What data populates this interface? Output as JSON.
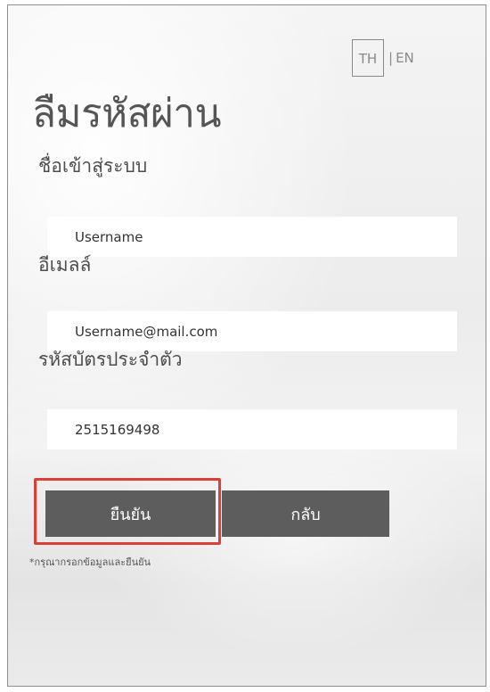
{
  "language": {
    "th_label": "TH",
    "separator": "|",
    "en_label": "EN",
    "active": "TH"
  },
  "title": "ลืมรหัสผ่าน",
  "form": {
    "username": {
      "label": "ชื่อเข้าสู่ระบบ",
      "value": "Username"
    },
    "email": {
      "label": "อีเมลล์",
      "value": "Username@mail.com"
    },
    "id_card": {
      "label": "รหัสบัตรประจำตัว",
      "value": "2515169498"
    }
  },
  "buttons": {
    "confirm_label": "ยืนยัน",
    "back_label": "กลับ"
  },
  "hint": "*กรุณากรอกข้อมูลและยืนยัน",
  "colors": {
    "button": "#5d5d5d",
    "highlight": "#d9403a",
    "title_text": "#555555"
  }
}
